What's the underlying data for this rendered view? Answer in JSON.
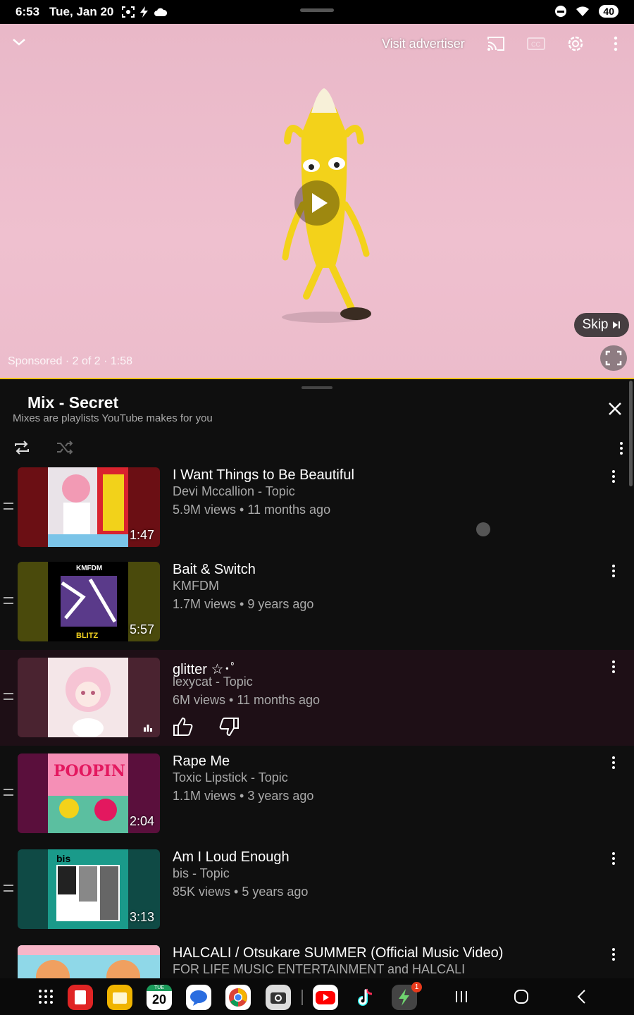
{
  "status_bar": {
    "time": "6:53",
    "date": "Tue, Jan 20",
    "battery": "40"
  },
  "video": {
    "visit_advertiser": "Visit advertiser",
    "ad_info": "Sponsored · 2 of 2 · 1:58",
    "skip_label": "Skip",
    "progress_color": "#f0c419",
    "background_color": "#efc0cf"
  },
  "playlist": {
    "title": "Mix - Secret",
    "subtitle": "Mixes are playlists YouTube makes for you",
    "items": [
      {
        "title": "I Want Things to Be Beautiful",
        "channel": "Devi Mccallion - Topic",
        "meta": "5.9M views • 11 months ago",
        "duration": "1:47"
      },
      {
        "title": "Bait & Switch",
        "channel": "KMFDM",
        "meta": "1.7M views • 9 years ago",
        "duration": "5:57"
      },
      {
        "title": "glitter ☆･ﾟ",
        "channel": "lexycat - Topic",
        "meta": "6M views • 11 months ago",
        "duration": ""
      },
      {
        "title": "Rape Me",
        "channel": "Toxic Lipstick - Topic",
        "meta": "1.1M views • 3 years ago",
        "duration": "2:04"
      },
      {
        "title": "Am I Loud Enough",
        "channel": "bis - Topic",
        "meta": "85K views • 5 years ago",
        "duration": "3:13"
      },
      {
        "title": "HALCALI / Otsukare SUMMER (Official Music Video)",
        "channel": "FOR LIFE MUSIC ENTERTAINMENT and HALCALI",
        "meta": "",
        "duration": ""
      }
    ]
  },
  "taskbar": {
    "calendar_day": "20",
    "calendar_weekday": "TUE",
    "notification_badge": "1"
  }
}
